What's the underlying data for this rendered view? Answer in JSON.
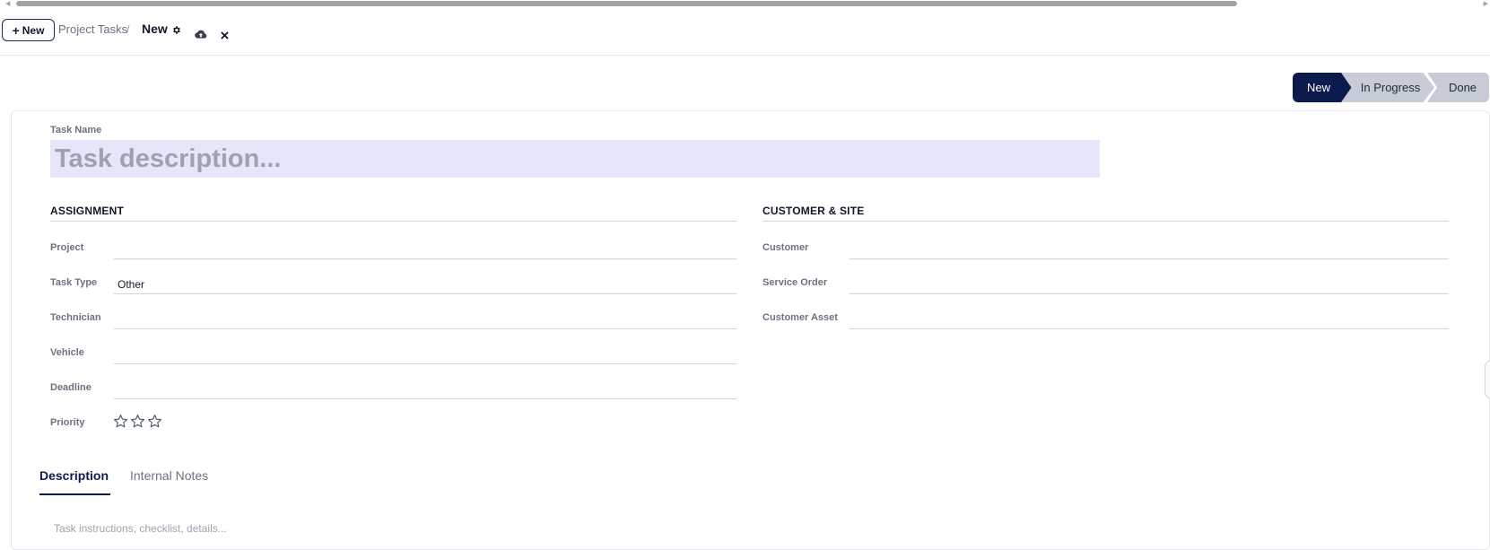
{
  "breadcrumb": {
    "new_button_label": "New",
    "parent": "Project Tasks",
    "separator": "/",
    "current": "New"
  },
  "icons": {
    "gear": "gear-icon",
    "save": "cloud-upload-icon",
    "discard": "close-icon",
    "plus": "plus-icon",
    "star": "star-outline-icon"
  },
  "status": {
    "steps": [
      "New",
      "In Progress",
      "Done"
    ],
    "active": "New",
    "active_color": "#0c1a4d",
    "inactive_color": "#c7cbd8"
  },
  "task": {
    "label": "Task Name",
    "placeholder": "Task description..."
  },
  "assignment": {
    "title": "ASSIGNMENT",
    "fields": [
      {
        "label": "Project",
        "value": ""
      },
      {
        "label": "Task Type",
        "value": "Other"
      },
      {
        "label": "Technician",
        "value": ""
      },
      {
        "label": "Vehicle",
        "value": ""
      },
      {
        "label": "Deadline",
        "value": ""
      },
      {
        "label": "Priority",
        "value": 0,
        "max": 3
      }
    ]
  },
  "customer": {
    "title": "CUSTOMER & SITE",
    "fields": [
      {
        "label": "Customer",
        "value": ""
      },
      {
        "label": "Service Order",
        "value": ""
      },
      {
        "label": "Customer Asset",
        "value": ""
      }
    ]
  },
  "tabs": [
    {
      "label": "Description",
      "active": true
    },
    {
      "label": "Internal Notes",
      "active": false
    }
  ],
  "description": {
    "placeholder": "Task instructions, checklist, details..."
  }
}
